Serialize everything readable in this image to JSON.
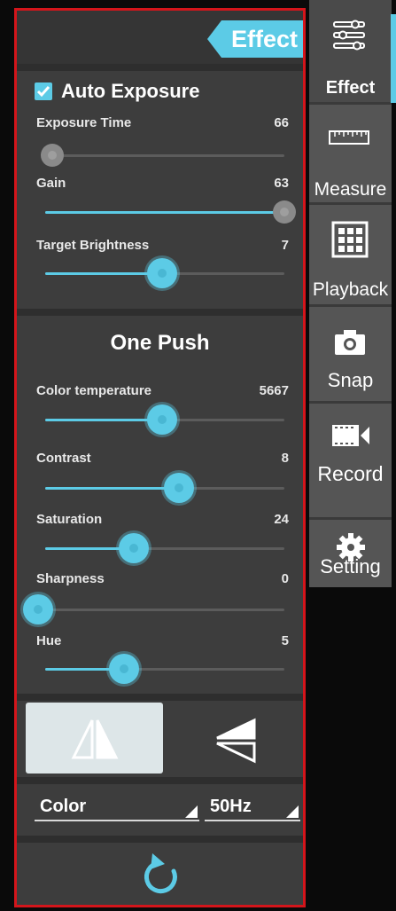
{
  "panel": {
    "tab_label": "Effect",
    "auto_exposure": {
      "label": "Auto Exposure",
      "checked": true
    },
    "sliders": {
      "exposure_time": {
        "label": "Exposure Time",
        "value": "66",
        "level": 0.03
      },
      "gain": {
        "label": "Gain",
        "value": "63",
        "level": 1.0
      },
      "target_brightness": {
        "label": "Target Brightness",
        "value": "7",
        "level": 0.49
      },
      "color_temperature": {
        "label": "Color temperature",
        "value": "5667",
        "level": 0.49
      },
      "contrast": {
        "label": "Contrast",
        "value": "8",
        "level": 0.56
      },
      "saturation": {
        "label": "Saturation",
        "value": "24",
        "level": 0.37
      },
      "sharpness": {
        "label": "Sharpness",
        "value": "0",
        "level": 0.0
      },
      "hue": {
        "label": "Hue",
        "value": "5",
        "level": 0.33
      }
    },
    "one_push_label": "One Push",
    "color_select": "Color",
    "frequency_select": "50Hz"
  },
  "sidebar": {
    "items": [
      {
        "label": "Effect",
        "icon": "sliders-icon",
        "active": true
      },
      {
        "label": "Measure",
        "icon": "ruler-icon",
        "active": false
      },
      {
        "label": "Playback",
        "icon": "grid-icon",
        "active": false
      },
      {
        "label": "Snap",
        "icon": "camera-icon",
        "active": false
      },
      {
        "label": "Record",
        "icon": "film-icon",
        "active": false
      },
      {
        "label": "Setting",
        "icon": "gear-icon",
        "active": false
      }
    ]
  },
  "colors": {
    "accent": "#5ccbe6",
    "panel_bg": "#3d3d3d",
    "border": "#d4151b"
  }
}
